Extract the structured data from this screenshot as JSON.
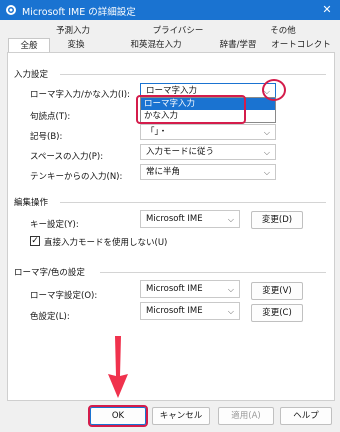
{
  "window": {
    "title": "Microsoft IME の詳細設定",
    "close": "✕"
  },
  "tabs_top": [
    "予測入力",
    "プライバシー",
    "その他"
  ],
  "tabs_bottom": [
    "全般",
    "変換",
    "和英混在入力",
    "辞書/学習",
    "オートコレクト"
  ],
  "sections": {
    "input": "入力設定",
    "edit": "編集操作",
    "romaji": "ローマ字/色の設定"
  },
  "input_settings": {
    "romaji_kana_label": "ローマ字入力/かな入力(I):",
    "romaji_kana_value": "ローマ字入力",
    "punctuation_label": "句読点(T):",
    "symbol_label": "記号(B):",
    "symbol_value": "「」・",
    "space_label": "スペースの入力(P):",
    "space_value": "入力モードに従う",
    "tenkey_label": "テンキーからの入力(N):",
    "tenkey_value": "常に半角"
  },
  "dropdown_options": [
    "ローマ字入力",
    "かな入力"
  ],
  "edit_ops": {
    "key_label": "キー設定(Y):",
    "key_value": "Microsoft IME",
    "change_d": "変更(D)",
    "direct_input": "直接入力モードを使用しない(U)"
  },
  "romaji_color": {
    "romaji_label": "ローマ字設定(O):",
    "romaji_value": "Microsoft IME",
    "change_v": "変更(V)",
    "color_label": "色設定(L):",
    "color_value": "Microsoft IME",
    "change_c": "変更(C)"
  },
  "buttons": {
    "ok": "OK",
    "cancel": "キャンセル",
    "apply": "適用(A)",
    "help": "ヘルプ"
  },
  "colors": {
    "accent": "#1a73d1",
    "annotation": "#d41c4b"
  },
  "icons": {
    "title": "ime-gear-icon",
    "chevron": "chevron-down-icon",
    "arrow": "down-arrow-annotation"
  }
}
